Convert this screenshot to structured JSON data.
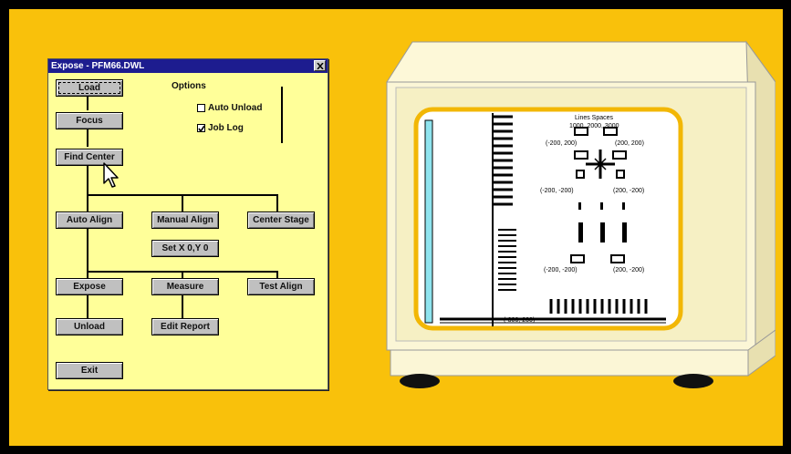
{
  "window": {
    "title": "Expose - PFM66.DWL",
    "close_label": "close"
  },
  "options": {
    "title": "Options",
    "auto_unload": {
      "label": "Auto Unload",
      "checked": false
    },
    "job_log": {
      "label": "Job Log",
      "checked": true
    }
  },
  "buttons": {
    "load": "Load",
    "focus": "Focus",
    "find_center": "Find Center",
    "auto_align": "Auto Align",
    "manual_align": "Manual Align",
    "center_stage": "Center Stage",
    "set_xy": "Set X 0,Y 0",
    "expose": "Expose",
    "measure": "Measure",
    "test_align": "Test Align",
    "unload": "Unload",
    "edit_report": "Edit Report",
    "exit": "Exit"
  },
  "screen_labels": {
    "top_label_1": "Lines   Spaces",
    "top_label_2": "1000, 2000, 3000",
    "coord_tl": "(-200, 200)",
    "coord_tr": "(200, 200)",
    "coord_ml": "(-200, -200)",
    "coord_mr": "(200, -200)",
    "coord_bl": "(-200, -200)",
    "coord_br": "(200, -200)",
    "bottom_label": "(-300, 200)"
  },
  "colors": {
    "background": "#f9c10b",
    "window": "#ffff99",
    "titlebar": "#1d1c8f",
    "button": "#c0c0c0",
    "monitor_body": "#fbf6d6",
    "screen_border": "#f2b705"
  },
  "icons": {
    "cursor": "arrow-pointer-icon",
    "close": "close-icon",
    "check": "checkmark-icon"
  }
}
